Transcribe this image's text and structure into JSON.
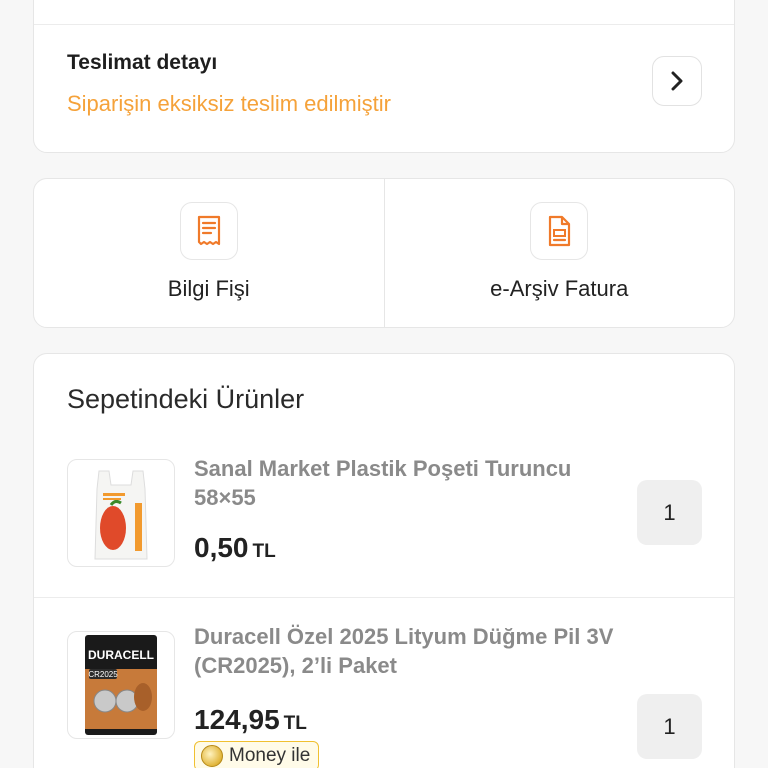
{
  "delivery": {
    "title": "Teslimat detayı",
    "status": "Siparişin eksiksiz teslim edilmiştir",
    "accent": "#f5a23a"
  },
  "documents": [
    {
      "label": "Bilgi Fişi",
      "icon": "receipt-icon"
    },
    {
      "label": "e-Arşiv Fatura",
      "icon": "invoice-document-icon"
    }
  ],
  "basket": {
    "title": "Sepetindeki Ürünler",
    "products": [
      {
        "name": "Sanal Market Plastik Poşeti Turuncu 58×55",
        "price": "0,50",
        "currency": "TL",
        "quantity": "1",
        "image": "plastic-bag-image"
      },
      {
        "name": "Duracell Özel 2025 Lityum Düğme Pil 3V (CR2025), 2’li Paket",
        "price": "124,95",
        "currency": "TL",
        "quantity": "1",
        "image": "duracell-battery-image",
        "badge": "Money ile"
      }
    ]
  }
}
